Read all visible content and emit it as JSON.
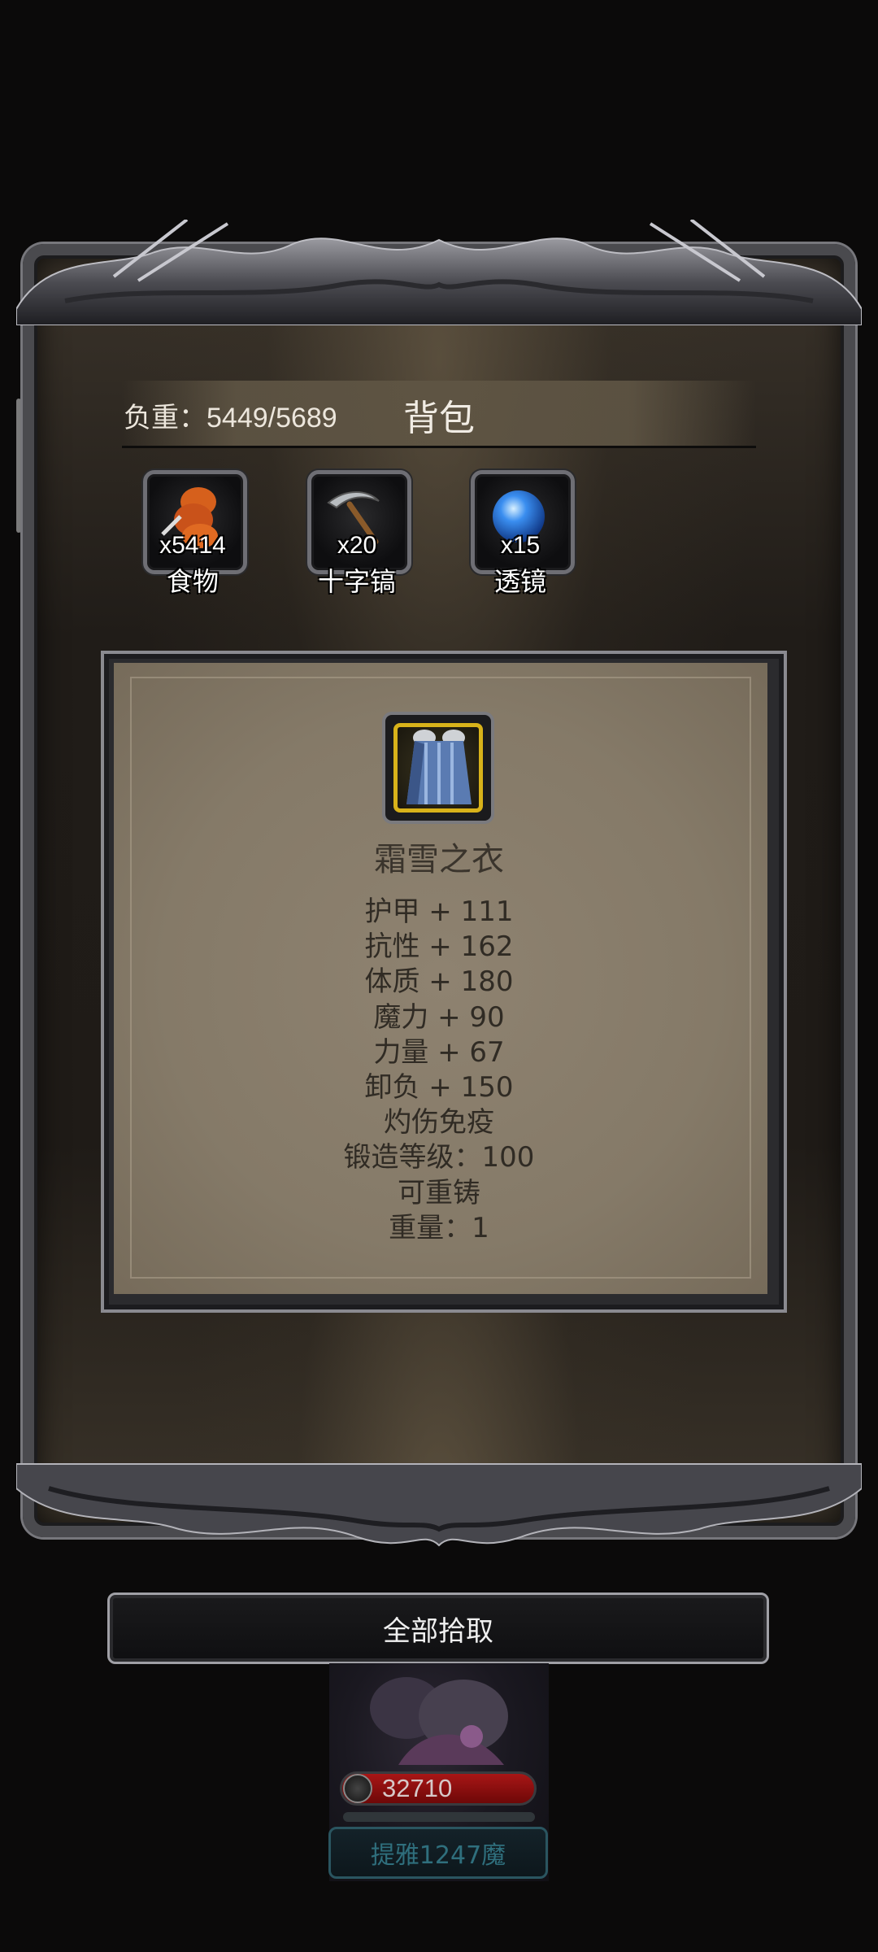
{
  "backpack": {
    "title": "背包",
    "weight_label": "负重：5449/5689"
  },
  "resources": [
    {
      "count": "x5414",
      "label": "食物",
      "icon": "food-icon"
    },
    {
      "count": "x20",
      "label": "十字镐",
      "icon": "pickaxe-icon"
    },
    {
      "count": "x15",
      "label": "透镜",
      "icon": "lens-icon"
    }
  ],
  "item": {
    "name": "霜雪之衣",
    "icon": "frost-cloak-icon",
    "stats": [
      "护甲 + 111",
      "抗性 + 162",
      "体质 + 180",
      "魔力 + 90",
      "力量 + 67",
      "卸负 + 150",
      "灼伤免疫",
      "锻造等级：100",
      "可重铸",
      "重量：1"
    ]
  },
  "actions": {
    "pickup_all": "全部拾取"
  },
  "character": {
    "hp_value": "32710",
    "rank_label": "提雅1247魔"
  },
  "colors": {
    "item_border_gold": "#d8b21a",
    "hp_red": "#a81616",
    "rank_teal": "#2f6f7d"
  }
}
